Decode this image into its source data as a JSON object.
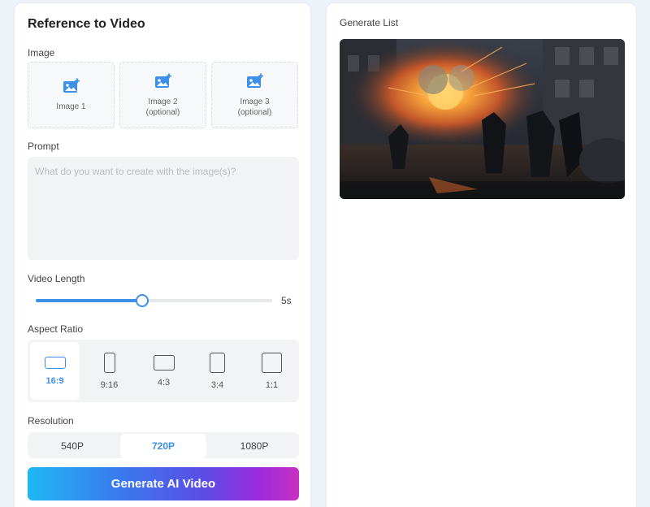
{
  "form": {
    "title": "Reference to Video",
    "image_label": "Image",
    "uploads": [
      {
        "label": "Image 1",
        "sub": ""
      },
      {
        "label": "Image 2",
        "sub": "(optional)"
      },
      {
        "label": "Image 3",
        "sub": "(optional)"
      }
    ],
    "prompt_label": "Prompt",
    "prompt_placeholder": "What do you want to create with the image(s)?",
    "prompt_value": "",
    "length_label": "Video Length",
    "length_value": "5s",
    "length_fraction": 0.45,
    "aspect_label": "Aspect Ratio",
    "aspect_options": [
      "16:9",
      "9:16",
      "4:3",
      "3:4",
      "1:1"
    ],
    "aspect_selected": "16:9",
    "resolution_label": "Resolution",
    "resolution_options": [
      "540P",
      "720P",
      "1080P"
    ],
    "resolution_selected": "720P",
    "generate_label": "Generate AI Video"
  },
  "list": {
    "title": "Generate List"
  },
  "colors": {
    "accent": "#3d8fe8",
    "panel_bg": "#ffffff",
    "page_bg": "#eef3fa"
  },
  "icons": {
    "upload": "add-image-icon",
    "ratio": "aspect-ratio-shape-icon"
  }
}
